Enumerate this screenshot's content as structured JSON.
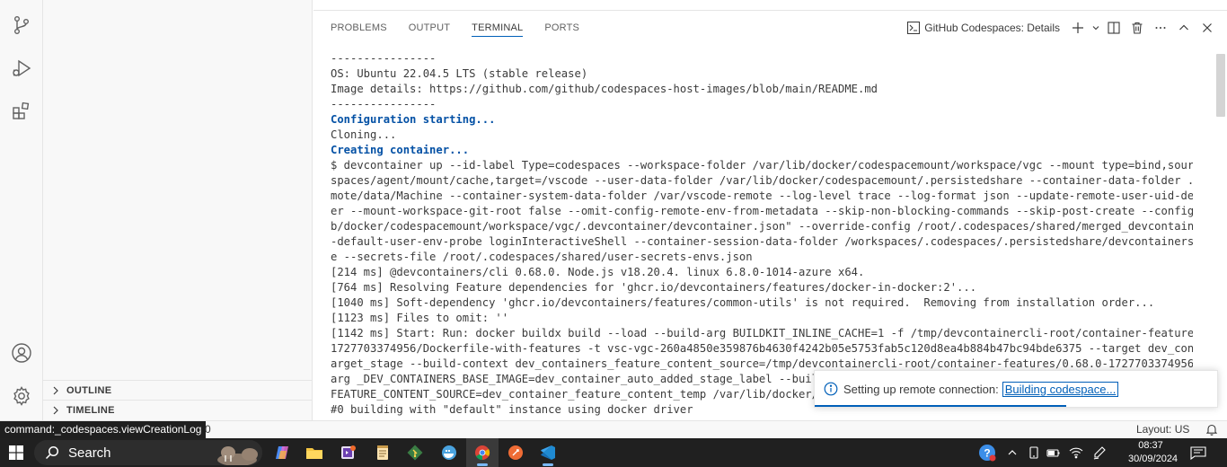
{
  "panel": {
    "tabs": [
      {
        "label": "PROBLEMS"
      },
      {
        "label": "OUTPUT"
      },
      {
        "label": "TERMINAL"
      },
      {
        "label": "PORTS"
      }
    ],
    "active_tab": "TERMINAL",
    "terminal_name": "GitHub Codespaces: Details"
  },
  "sidebar": {
    "outline_label": "OUTLINE",
    "timeline_label": "TIMELINE"
  },
  "terminal": {
    "lines": [
      {
        "text": "----------------",
        "highlight": false
      },
      {
        "text": "OS: Ubuntu 22.04.5 LTS (stable release)",
        "highlight": false
      },
      {
        "text": "Image details: https://github.com/github/codespaces-host-images/blob/main/README.md",
        "highlight": false
      },
      {
        "text": "----------------",
        "highlight": false
      },
      {
        "text": "Configuration starting...",
        "highlight": true
      },
      {
        "text": "Cloning...",
        "highlight": false
      },
      {
        "text": "Creating container...",
        "highlight": true
      },
      {
        "text": "$ devcontainer up --id-label Type=codespaces --workspace-folder /var/lib/docker/codespacemount/workspace/vgc --mount type=bind,source=/.code",
        "highlight": false
      },
      {
        "text": "spaces/agent/mount/cache,target=/vscode --user-data-folder /var/lib/docker/codespacemount/.persistedshare --container-data-folder .vscode-re",
        "highlight": false
      },
      {
        "text": "mote/data/Machine --container-system-data-folder /var/vscode-remote --log-level trace --log-format json --update-remote-user-uid-default nev",
        "highlight": false
      },
      {
        "text": "er --mount-workspace-git-root false --omit-config-remote-env-from-metadata --skip-non-blocking-commands --skip-post-create --config \"/var/li",
        "highlight": false
      },
      {
        "text": "b/docker/codespacemount/workspace/vgc/.devcontainer/devcontainer.json\" --override-config /root/.codespaces/shared/merged_devcontainer.json -",
        "highlight": false
      },
      {
        "text": "-default-user-env-probe loginInteractiveShell --container-session-data-folder /workspaces/.codespaces/.persistedshare/devcontainers-cli/cach",
        "highlight": false
      },
      {
        "text": "e --secrets-file /root/.codespaces/shared/user-secrets-envs.json",
        "highlight": false
      },
      {
        "text": "[214 ms] @devcontainers/cli 0.68.0. Node.js v18.20.4. linux 6.8.0-1014-azure x64.",
        "highlight": false
      },
      {
        "text": "[764 ms] Resolving Feature dependencies for 'ghcr.io/devcontainers/features/docker-in-docker:2'...",
        "highlight": false
      },
      {
        "text": "[1040 ms] Soft-dependency 'ghcr.io/devcontainers/features/common-utils' is not required.  Removing from installation order...",
        "highlight": false
      },
      {
        "text": "[1123 ms] Files to omit: ''",
        "highlight": false
      },
      {
        "text": "[1142 ms] Start: Run: docker buildx build --load --build-arg BUILDKIT_INLINE_CACHE=1 -f /tmp/devcontainercli-root/container-features/0.68.0-",
        "highlight": false
      },
      {
        "text": "1727703374956/Dockerfile-with-features -t vsc-vgc-260a4850e359876b4630f4242b05e5753fab5c120d8ea4b884b47bc94bde6375 --target dev_containers_t",
        "highlight": false
      },
      {
        "text": "arget_stage --build-context dev_containers_feature_content_source=/tmp/devcontainercli-root/container-features/0.68.0-1727703374956 --build-",
        "highlight": false
      },
      {
        "text": "arg _DEV_CONTAINERS_BASE_IMAGE=dev_container_auto_added_stage_label --build-a",
        "highlight": false
      },
      {
        "text": "FEATURE_CONTENT_SOURCE=dev_container_feature_content_temp /var/lib/docker/cod",
        "highlight": false
      },
      {
        "text": "#0 building with \"default\" instance using docker driver",
        "highlight": false
      }
    ]
  },
  "notification": {
    "message": "Setting up remote connection:",
    "link": "Building codespace..."
  },
  "statusbar": {
    "tooltip": "command:_codespaces.viewCreationLog",
    "count": "0",
    "layout": "Layout: US"
  },
  "taskbar": {
    "search_label": "Search",
    "time": "08:37",
    "date": "30/09/2024"
  },
  "colors": {
    "accent": "#005fb8",
    "terminal_highlight": "#0451a5",
    "taskbar_bg": "#202020"
  }
}
